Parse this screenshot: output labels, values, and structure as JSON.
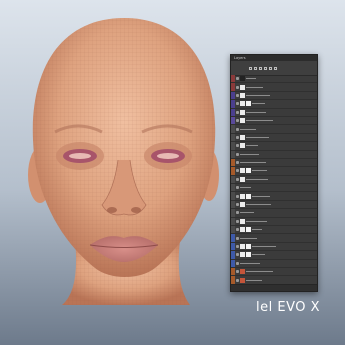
{
  "caption": "lel EVO X",
  "colors": {
    "background_top": "#dde4ec",
    "background_bottom": "#6d7a8b",
    "skin": "#e2a989",
    "lips": "#c97e7a",
    "panel_bg": "#3b3b3b",
    "panel_bar": "#2c2c2c"
  },
  "layers_panel": {
    "title": "Layers",
    "toolbar_icons": [
      "filter-pixel-icon",
      "filter-adjustment-icon",
      "filter-type-icon",
      "filter-shape-icon",
      "filter-smart-icon",
      "lock-icon"
    ],
    "rows": [
      {
        "color": "#8a3a3a",
        "thumb": "dark",
        "mask": false
      },
      {
        "color": "#8a3a3a",
        "thumb": "light",
        "mask": false
      },
      {
        "color": "#4b3f8e",
        "thumb": "light",
        "mask": false
      },
      {
        "color": "#4b3f8e",
        "thumb": "light",
        "mask": true
      },
      {
        "color": "#4b3f8e",
        "thumb": "light",
        "mask": false
      },
      {
        "color": "#5a4a9a",
        "thumb": "light",
        "mask": false
      },
      {
        "color": "#4b4b4b",
        "thumb": "none",
        "mask": false
      },
      {
        "color": "#4b4b4b",
        "thumb": "light",
        "mask": false
      },
      {
        "color": "#4b4b4b",
        "thumb": "light",
        "mask": false
      },
      {
        "color": "#4b4b4b",
        "thumb": "none",
        "mask": false
      },
      {
        "color": "#a55a2a",
        "thumb": "none",
        "mask": false
      },
      {
        "color": "#a55a2a",
        "thumb": "light",
        "mask": true
      },
      {
        "color": "#4b4b4b",
        "thumb": "light",
        "mask": false
      },
      {
        "color": "#4b4b4b",
        "thumb": "none",
        "mask": false
      },
      {
        "color": "#4b4b4b",
        "thumb": "light",
        "mask": true
      },
      {
        "color": "#4b4b4b",
        "thumb": "light",
        "mask": false
      },
      {
        "color": "#4b4b4b",
        "thumb": "none",
        "mask": false
      },
      {
        "color": "#4b4b4b",
        "thumb": "light",
        "mask": false
      },
      {
        "color": "#4b4b4b",
        "thumb": "light",
        "mask": true
      },
      {
        "color": "#3e5aa8",
        "thumb": "none",
        "mask": false
      },
      {
        "color": "#3e5aa8",
        "thumb": "light",
        "mask": true
      },
      {
        "color": "#3e5aa8",
        "thumb": "light",
        "mask": true
      },
      {
        "color": "#3e5aa8",
        "thumb": "none",
        "mask": false
      },
      {
        "color": "#a55a2a",
        "thumb": "red",
        "mask": false
      },
      {
        "color": "#a55a2a",
        "thumb": "red",
        "mask": false
      },
      {
        "color": "#a55a2a",
        "thumb": "red",
        "mask": false
      },
      {
        "color": "#a55a2a",
        "thumb": "red",
        "mask": false
      },
      {
        "color": "#a55a2a",
        "thumb": "red",
        "mask": false
      },
      {
        "color": "#a55a2a",
        "thumb": "none",
        "mask": false
      },
      {
        "color": "#4b4b4b",
        "thumb": "none",
        "mask": false
      }
    ]
  }
}
